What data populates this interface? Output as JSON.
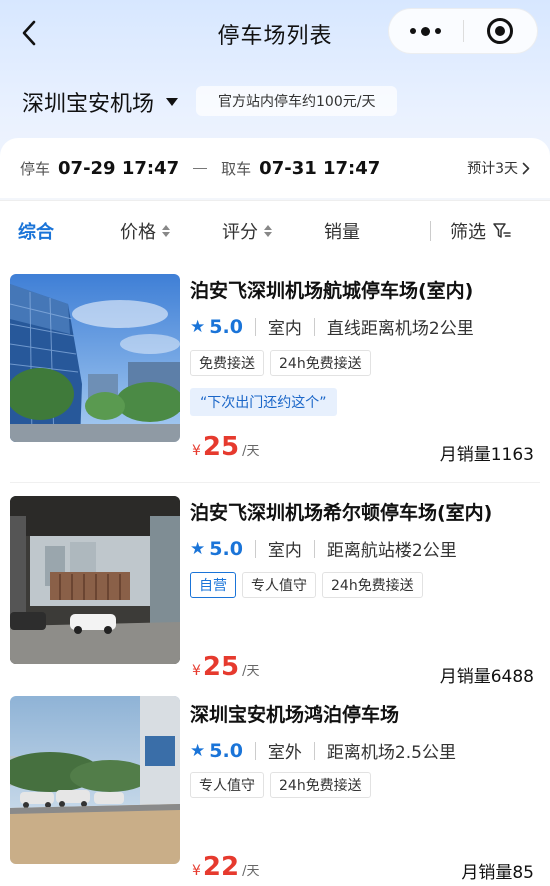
{
  "header": {
    "title": "停车场列表"
  },
  "location": {
    "name": "深圳宝安机场",
    "official_note": "官方站内停车约100元/天"
  },
  "dates": {
    "park_label": "停车",
    "park_value": "07-29 17:47",
    "pickup_label": "取车",
    "pickup_value": "07-31 17:47",
    "estimate": "预计3天"
  },
  "sort": {
    "overall": "综合",
    "price": "价格",
    "rating": "评分",
    "sales": "销量",
    "filter": "筛选"
  },
  "listings": [
    {
      "name": "泊安飞深圳机场航城停车场(室内)",
      "rating": "5.0",
      "type": "室内",
      "distance": "直线距离机场2公里",
      "tags": [
        "免费接送",
        "24h免费接送"
      ],
      "quote": "“下次出门还约这个”",
      "currency": "¥",
      "price": "25",
      "unit": "/天",
      "sales": "月销量1163"
    },
    {
      "name": "泊安飞深圳机场希尔顿停车场(室内)",
      "rating": "5.0",
      "type": "室内",
      "distance": "距离航站楼2公里",
      "tags": [
        "自营",
        "专人值守",
        "24h免费接送"
      ],
      "currency": "¥",
      "price": "25",
      "unit": "/天",
      "sales": "月销量6488"
    },
    {
      "name": "深圳宝安机场鸿泊停车场",
      "rating": "5.0",
      "type": "室外",
      "distance": "距离机场2.5公里",
      "tags": [
        "专人值守",
        "24h免费接送"
      ],
      "currency": "¥",
      "price": "22",
      "unit": "/天",
      "sales": "月销量85"
    }
  ],
  "colors": {
    "accent": "#1a74d8",
    "price": "#e63a2e"
  }
}
